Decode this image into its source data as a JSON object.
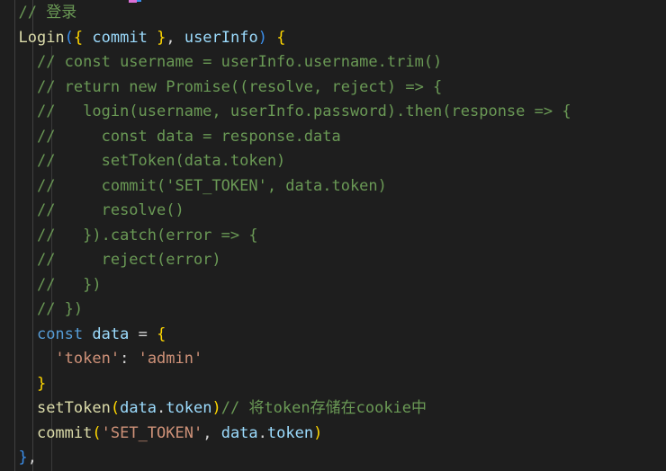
{
  "editor": {
    "name": "code-editor",
    "language": "javascript",
    "theme": "dark-plus",
    "background_color": "#1e1e1e",
    "font_size_px": 17,
    "line_height_px": 27.5,
    "colors": {
      "comment": "#6A9955",
      "function": "#DCDCAA",
      "keyword": "#569CD6",
      "variable": "#9CDCFE",
      "string": "#CE9178",
      "plain_text": "#D4D4D4",
      "bracket_yellow": "#FFD700",
      "bracket_purple": "#DA70D6",
      "bracket_blue": "#3B8EEA",
      "indent_guide": "#404040"
    },
    "indent_guides_x": [
      16,
      36,
      57
    ]
  },
  "code": {
    "full_text": "// 登录\nLogin({ commit }, userInfo) {\n  // const username = userInfo.username.trim()\n  // return new Promise((resolve, reject) => {\n  //   login(username, userInfo.password).then(response => {\n  //     const data = response.data\n  //     setToken(data.token)\n  //     commit('SET_TOKEN', data.token)\n  //     resolve()\n  //   }).catch(error => {\n  //     reject(error)\n  //   })\n  // })\n  const data = {\n    'token': 'admin'\n  }\n  setToken(data.token)// 将token存储在cookie中\n  commit('SET_TOKEN', data.token)\n},",
    "lines": [
      {
        "index": 1,
        "text": "  // 登录",
        "tokens": [
          {
            "t": "  ",
            "c": "plain"
          },
          {
            "t": "// 登录",
            "c": "cmt"
          }
        ]
      },
      {
        "index": 2,
        "text": "  Login({ commit }, userInfo) {",
        "tokens": [
          {
            "t": "  ",
            "c": "plain"
          },
          {
            "t": "Login",
            "c": "fn"
          },
          {
            "t": "(",
            "c": "br-b"
          },
          {
            "t": "{",
            "c": "br-y"
          },
          {
            "t": " ",
            "c": "plain"
          },
          {
            "t": "commit",
            "c": "var"
          },
          {
            "t": " ",
            "c": "plain"
          },
          {
            "t": "}",
            "c": "br-y"
          },
          {
            "t": ", ",
            "c": "plain"
          },
          {
            "t": "userInfo",
            "c": "var"
          },
          {
            "t": ")",
            "c": "br-b"
          },
          {
            "t": " ",
            "c": "plain"
          },
          {
            "t": "{",
            "c": "br-y"
          }
        ]
      },
      {
        "index": 3,
        "text": "    // const username = userInfo.username.trim()",
        "tokens": [
          {
            "t": "    ",
            "c": "plain"
          },
          {
            "t": "// const username = userInfo.username.trim()",
            "c": "cmt"
          }
        ]
      },
      {
        "index": 4,
        "text": "    // return new Promise((resolve, reject) => {",
        "tokens": [
          {
            "t": "    ",
            "c": "plain"
          },
          {
            "t": "// return new Promise((resolve, reject) => {",
            "c": "cmt"
          }
        ]
      },
      {
        "index": 5,
        "text": "    //   login(username, userInfo.password).then(response => {",
        "tokens": [
          {
            "t": "    ",
            "c": "plain"
          },
          {
            "t": "//   login(username, userInfo.password).then(response => {",
            "c": "cmt"
          }
        ]
      },
      {
        "index": 6,
        "text": "    //     const data = response.data",
        "tokens": [
          {
            "t": "    ",
            "c": "plain"
          },
          {
            "t": "//     const data = response.data",
            "c": "cmt"
          }
        ]
      },
      {
        "index": 7,
        "text": "    //     setToken(data.token)",
        "tokens": [
          {
            "t": "    ",
            "c": "plain"
          },
          {
            "t": "//     setToken(data.token)",
            "c": "cmt"
          }
        ]
      },
      {
        "index": 8,
        "text": "    //     commit('SET_TOKEN', data.token)",
        "tokens": [
          {
            "t": "    ",
            "c": "plain"
          },
          {
            "t": "//     commit('SET_TOKEN', data.token)",
            "c": "cmt"
          }
        ]
      },
      {
        "index": 9,
        "text": "    //     resolve()",
        "tokens": [
          {
            "t": "    ",
            "c": "plain"
          },
          {
            "t": "//     resolve()",
            "c": "cmt"
          }
        ]
      },
      {
        "index": 10,
        "text": "    //   }).catch(error => {",
        "tokens": [
          {
            "t": "    ",
            "c": "plain"
          },
          {
            "t": "//   }).catch(error => {",
            "c": "cmt"
          }
        ]
      },
      {
        "index": 11,
        "text": "    //     reject(error)",
        "tokens": [
          {
            "t": "    ",
            "c": "plain"
          },
          {
            "t": "//     reject(error)",
            "c": "cmt"
          }
        ]
      },
      {
        "index": 12,
        "text": "    //   })",
        "tokens": [
          {
            "t": "    ",
            "c": "plain"
          },
          {
            "t": "//   })",
            "c": "cmt"
          }
        ]
      },
      {
        "index": 13,
        "text": "    // })",
        "tokens": [
          {
            "t": "    ",
            "c": "plain"
          },
          {
            "t": "// })",
            "c": "cmt"
          }
        ]
      },
      {
        "index": 14,
        "text": "    const data = {",
        "tokens": [
          {
            "t": "    ",
            "c": "plain"
          },
          {
            "t": "const",
            "c": "kw"
          },
          {
            "t": " ",
            "c": "plain"
          },
          {
            "t": "data",
            "c": "var"
          },
          {
            "t": " ",
            "c": "plain"
          },
          {
            "t": "=",
            "c": "op"
          },
          {
            "t": " ",
            "c": "plain"
          },
          {
            "t": "{",
            "c": "br-y"
          }
        ]
      },
      {
        "index": 15,
        "text": "      'token': 'admin'",
        "tokens": [
          {
            "t": "      ",
            "c": "plain"
          },
          {
            "t": "'token'",
            "c": "str"
          },
          {
            "t": ":",
            "c": "op"
          },
          {
            "t": " ",
            "c": "plain"
          },
          {
            "t": "'admin'",
            "c": "str"
          }
        ]
      },
      {
        "index": 16,
        "text": "    }",
        "tokens": [
          {
            "t": "    ",
            "c": "plain"
          },
          {
            "t": "}",
            "c": "br-y"
          }
        ]
      },
      {
        "index": 17,
        "text": "    setToken(data.token)// 将token存储在cookie中",
        "tokens": [
          {
            "t": "    ",
            "c": "plain"
          },
          {
            "t": "setToken",
            "c": "fn"
          },
          {
            "t": "(",
            "c": "br-y"
          },
          {
            "t": "data",
            "c": "var"
          },
          {
            "t": ".",
            "c": "plain"
          },
          {
            "t": "token",
            "c": "var"
          },
          {
            "t": ")",
            "c": "br-y"
          },
          {
            "t": "// 将token存储在cookie中",
            "c": "cmt"
          }
        ]
      },
      {
        "index": 18,
        "text": "    commit('SET_TOKEN', data.token)",
        "tokens": [
          {
            "t": "    ",
            "c": "plain"
          },
          {
            "t": "commit",
            "c": "fn"
          },
          {
            "t": "(",
            "c": "br-y"
          },
          {
            "t": "'SET_TOKEN'",
            "c": "str"
          },
          {
            "t": ", ",
            "c": "plain"
          },
          {
            "t": "data",
            "c": "var"
          },
          {
            "t": ".",
            "c": "plain"
          },
          {
            "t": "token",
            "c": "var"
          },
          {
            "t": ")",
            "c": "br-y"
          }
        ]
      },
      {
        "index": 19,
        "text": "  },",
        "tokens": [
          {
            "t": "  ",
            "c": "plain"
          },
          {
            "t": "}",
            "c": "br-b"
          },
          {
            "t": ",",
            "c": "plain"
          }
        ]
      }
    ]
  }
}
